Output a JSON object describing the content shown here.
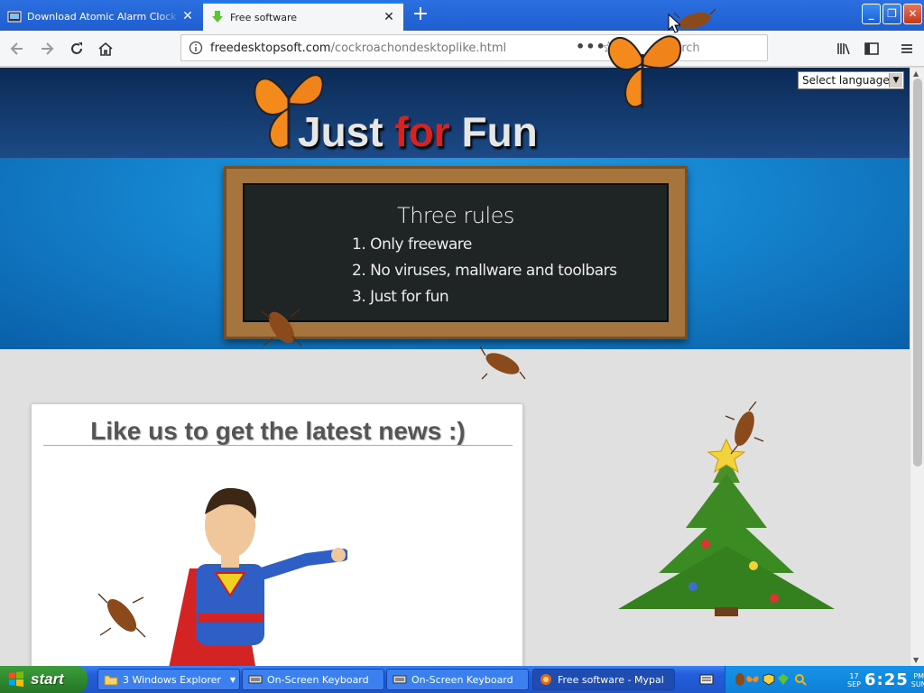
{
  "browser": {
    "tabs": [
      {
        "title": "Download Atomic Alarm Clock - Co",
        "active": false,
        "icon": "alarm-clock-icon"
      },
      {
        "title": "Free software",
        "active": true,
        "icon": "download-arrow-icon"
      }
    ],
    "new_tab": "+",
    "window_buttons": {
      "minimize": "_",
      "maximize": "❐",
      "close": "✕"
    },
    "url": {
      "domain": "freedesktopsoft.com",
      "path": "/cockroachondesktoplike.html"
    },
    "url_more": "•••",
    "search_placeholder": "Search"
  },
  "page": {
    "language_select": "Select language",
    "site_title": {
      "part1": "Just ",
      "part2": "for",
      "part3": " Fun"
    },
    "board": {
      "title": "Three rules",
      "rules": [
        "1. Only freeware",
        "2. No viruses, mallware and toolbars",
        "3. Just for fun"
      ]
    },
    "panel_title": "Like us to get the latest news :)"
  },
  "taskbar": {
    "start_label": "start",
    "items": [
      {
        "label": "3 Windows Explorer",
        "icon": "folder-icon"
      },
      {
        "label": "On-Screen Keyboard",
        "icon": "keyboard-icon"
      },
      {
        "label": "On-Screen Keyboard",
        "icon": "keyboard-icon"
      },
      {
        "label": "Free software - Mypal",
        "icon": "browser-icon"
      }
    ],
    "clock": {
      "day_num": "17",
      "month": "SEP",
      "time": "6:25",
      "ampm": "PM",
      "weekday": "SUN"
    }
  },
  "colors": {
    "accent": "#0a84ff",
    "title_red": "#d42323",
    "taskbar_blue": "#245edb",
    "start_green": "#2f8a2f"
  }
}
